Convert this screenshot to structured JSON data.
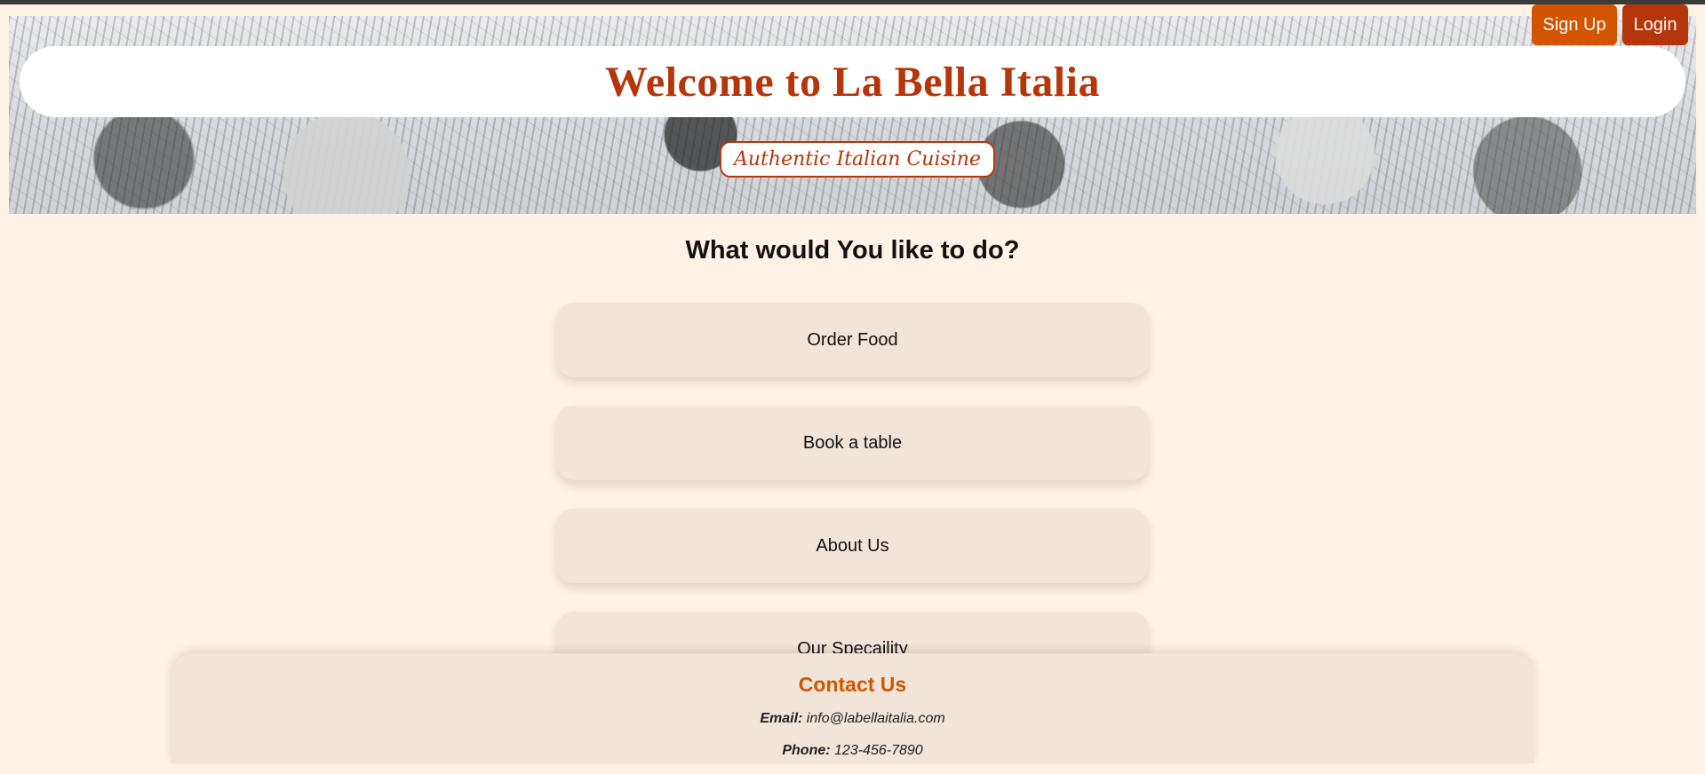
{
  "header": {
    "title": "Welcome to La Bella Italia",
    "tagline": "Authentic Italian Cuisine",
    "signup_label": "Sign Up",
    "login_label": "Login"
  },
  "main": {
    "heading": "What would You like to do?",
    "options": [
      {
        "label": "Order Food"
      },
      {
        "label": "Book a table"
      },
      {
        "label": "About Us"
      },
      {
        "label": "Our Specaility"
      }
    ]
  },
  "contact": {
    "title": "Contact Us",
    "email_label": "Email:",
    "email_value": "info@labellaitalia.com",
    "phone_label": "Phone:",
    "phone_value": "123-456-7890"
  },
  "colors": {
    "accent": "#d35400",
    "brand": "#b5360a",
    "background": "#fdf2e5",
    "card": "#f1e4d8"
  }
}
